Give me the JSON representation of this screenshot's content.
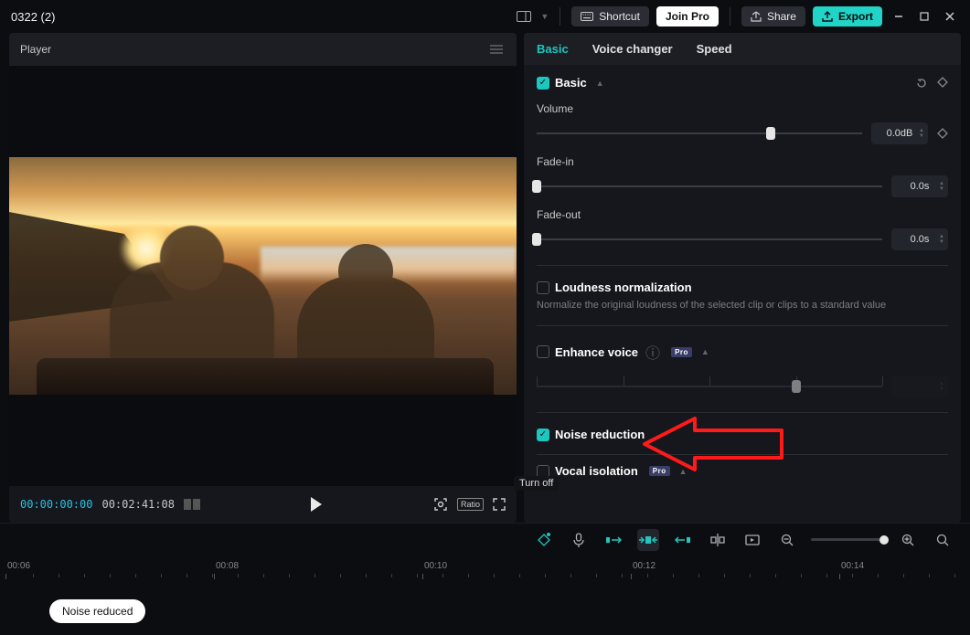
{
  "project_title": "0322 (2)",
  "topbar": {
    "shortcut": "Shortcut",
    "join_pro": "Join Pro",
    "share": "Share",
    "export": "Export"
  },
  "player": {
    "header": "Player",
    "current_tc": "00:00:00:00",
    "duration_tc": "00:02:41:08",
    "ratio_label": "Ratio"
  },
  "tabs": {
    "basic": "Basic",
    "voice_changer": "Voice changer",
    "speed": "Speed"
  },
  "sections": {
    "basic_label": "Basic",
    "volume": {
      "label": "Volume",
      "value": "0.0dB"
    },
    "fade_in": {
      "label": "Fade-in",
      "value": "0.0s"
    },
    "fade_out": {
      "label": "Fade-out",
      "value": "0.0s"
    },
    "loudness": {
      "label": "Loudness normalization",
      "desc": "Normalize the original loudness of the selected clip or clips to a standard value"
    },
    "enhance_voice": {
      "label": "Enhance voice",
      "pro": "Pro"
    },
    "noise_reduction": {
      "label": "Noise reduction"
    },
    "vocal_isolation": {
      "label": "Vocal isolation",
      "pro": "Pro"
    }
  },
  "tooltip_turnoff": "Turn off",
  "timeline": {
    "ticks": [
      "00:06",
      "00:08",
      "00:10",
      "00:12",
      "00:14"
    ]
  },
  "toast": "Noise reduced"
}
